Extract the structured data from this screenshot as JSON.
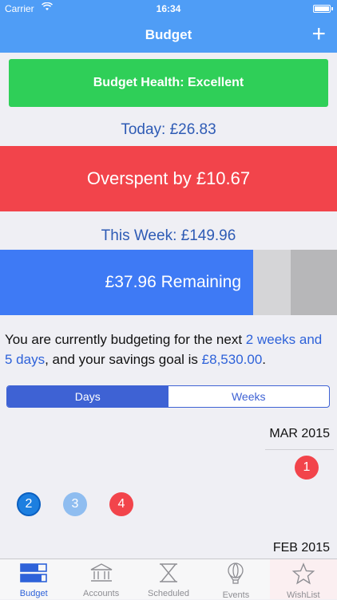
{
  "status": {
    "carrier": "Carrier",
    "time": "16:34"
  },
  "nav": {
    "title": "Budget",
    "add_symbol": "+"
  },
  "health": {
    "label": "Budget Health: Excellent",
    "color": "#2fcf58"
  },
  "today": {
    "label": "Today: £26.83"
  },
  "overspent": {
    "label": "Overspent by £10.67",
    "color": "#f2444b"
  },
  "week": {
    "label": "This Week: £149.96",
    "remaining_label": "£37.96 Remaining",
    "remaining_fraction": 0.75,
    "color": "#3e7af5"
  },
  "info": {
    "prefix": "You are currently budgeting for the next ",
    "duration": "2 weeks and 5 days",
    "middle": ", and your savings goal is ",
    "goal": "£8,530.00",
    "suffix": "."
  },
  "segment": {
    "days": "Days",
    "weeks": "Weeks",
    "selected": "Days"
  },
  "calendar": {
    "months": [
      {
        "label": "MAR 2015"
      },
      {
        "label": "FEB 2015"
      }
    ],
    "events": [
      {
        "number": "1",
        "color": "#f2444b"
      },
      {
        "number": "2",
        "color": "#1d7fe0"
      },
      {
        "number": "3",
        "color": "#8fbdf0"
      },
      {
        "number": "4",
        "color": "#f2444b"
      }
    ]
  },
  "tabs": [
    {
      "label": "Budget",
      "icon": "budget-icon"
    },
    {
      "label": "Accounts",
      "icon": "bank-icon"
    },
    {
      "label": "Scheduled",
      "icon": "hourglass-icon"
    },
    {
      "label": "Events",
      "icon": "balloon-icon"
    },
    {
      "label": "WishList",
      "icon": "star-icon"
    }
  ]
}
